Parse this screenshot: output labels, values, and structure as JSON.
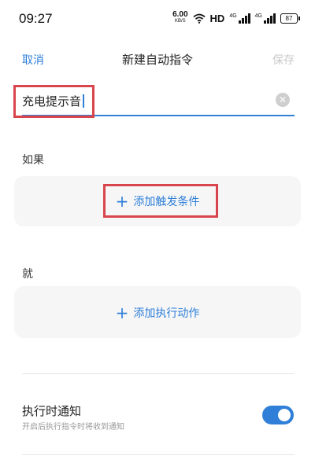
{
  "status_bar": {
    "time": "09:27",
    "net_speed": "6.00",
    "net_unit": "KB/S",
    "hd": "HD",
    "signal1_label": "4G",
    "signal2_label": "4G",
    "battery": "87"
  },
  "header": {
    "cancel": "取消",
    "title": "新建自动指令",
    "save": "保存"
  },
  "name_field": {
    "value": "充电提示音"
  },
  "if_section": {
    "label": "如果",
    "add_button": "添加触发条件"
  },
  "then_section": {
    "label": "就",
    "add_button": "添加执行动作"
  },
  "notify": {
    "title": "执行时通知",
    "subtitle": "开启后执行指令时将收到通知",
    "enabled": true
  },
  "colors": {
    "accent": "#2f7fd8",
    "highlight": "#d9454c",
    "card_bg": "#f6f6f7"
  }
}
